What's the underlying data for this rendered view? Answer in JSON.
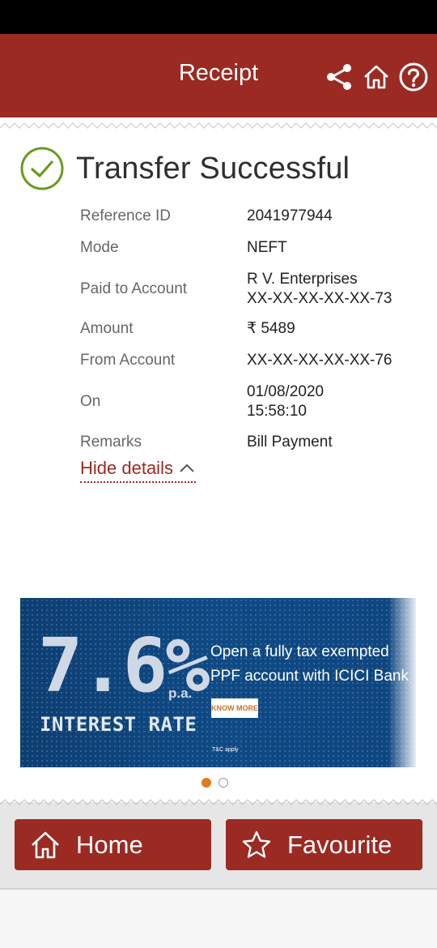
{
  "header": {
    "title": "Receipt"
  },
  "icons": {
    "share": "share-icon",
    "home": "home-icon",
    "help": "help-icon",
    "success": "check-circle-icon",
    "chevron": "chevron-up-icon",
    "favourite": "star-icon"
  },
  "colors": {
    "brand": "#9b2a22",
    "success": "#6a9a1f",
    "accent": "#e07b22"
  },
  "receipt": {
    "status": "Transfer Successful",
    "rows": [
      {
        "label": "Reference ID",
        "value": "2041977944"
      },
      {
        "label": "Mode",
        "value": "NEFT"
      },
      {
        "label": "Paid to Account",
        "value": "R V. Enterprises",
        "value2": "XX-XX-XX-XX-XX-73"
      },
      {
        "label": "Amount",
        "value": "₹ 5489"
      },
      {
        "label": "From Account",
        "value": "XX-XX-XX-XX-XX-76"
      },
      {
        "label": "On",
        "value": "01/08/2020",
        "value2": "15:58:10"
      },
      {
        "label": "Remarks",
        "value": "Bill Payment"
      }
    ],
    "toggle_label": "Hide details"
  },
  "banner": {
    "rate": "7.6%",
    "pa": "p.a.",
    "rate_label": "INTEREST RATE",
    "text": "Open a fully tax exempted PPF account with ICICI Bank",
    "cta": "KNOW MORE",
    "tnc": "T&C apply"
  },
  "carousel": {
    "current_page": 1,
    "total_pages": 2
  },
  "actions": {
    "home_label": "Home",
    "favourite_label": "Favourite"
  }
}
